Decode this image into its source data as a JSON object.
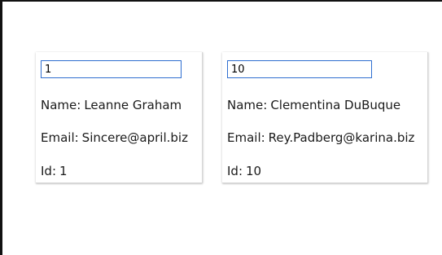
{
  "cards": [
    {
      "input_value": "1",
      "name_label": "Name:",
      "name": "Leanne Graham",
      "email_label": "Email:",
      "email": "Sincere@april.biz",
      "id_label": "Id:",
      "id": "1"
    },
    {
      "input_value": "10",
      "name_label": "Name:",
      "name": "Clementina DuBuque",
      "email_label": "Email:",
      "email": "Rey.Padberg@karina.biz",
      "id_label": "Id:",
      "id": "10"
    }
  ],
  "colors": {
    "input_border": "#2f6fd0",
    "frame": "#111111",
    "text": "#1a1a1a"
  }
}
